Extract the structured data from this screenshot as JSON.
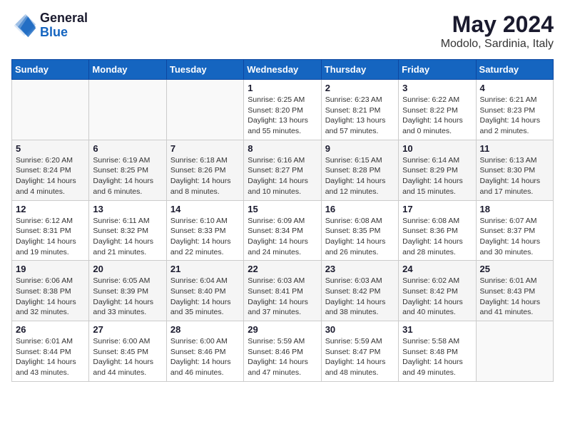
{
  "header": {
    "logo_line1": "General",
    "logo_line2": "Blue",
    "month_title": "May 2024",
    "location": "Modolo, Sardinia, Italy"
  },
  "days_of_week": [
    "Sunday",
    "Monday",
    "Tuesday",
    "Wednesday",
    "Thursday",
    "Friday",
    "Saturday"
  ],
  "weeks": [
    [
      {
        "day": "",
        "info": ""
      },
      {
        "day": "",
        "info": ""
      },
      {
        "day": "",
        "info": ""
      },
      {
        "day": "1",
        "info": "Sunrise: 6:25 AM\nSunset: 8:20 PM\nDaylight: 13 hours\nand 55 minutes."
      },
      {
        "day": "2",
        "info": "Sunrise: 6:23 AM\nSunset: 8:21 PM\nDaylight: 13 hours\nand 57 minutes."
      },
      {
        "day": "3",
        "info": "Sunrise: 6:22 AM\nSunset: 8:22 PM\nDaylight: 14 hours\nand 0 minutes."
      },
      {
        "day": "4",
        "info": "Sunrise: 6:21 AM\nSunset: 8:23 PM\nDaylight: 14 hours\nand 2 minutes."
      }
    ],
    [
      {
        "day": "5",
        "info": "Sunrise: 6:20 AM\nSunset: 8:24 PM\nDaylight: 14 hours\nand 4 minutes."
      },
      {
        "day": "6",
        "info": "Sunrise: 6:19 AM\nSunset: 8:25 PM\nDaylight: 14 hours\nand 6 minutes."
      },
      {
        "day": "7",
        "info": "Sunrise: 6:18 AM\nSunset: 8:26 PM\nDaylight: 14 hours\nand 8 minutes."
      },
      {
        "day": "8",
        "info": "Sunrise: 6:16 AM\nSunset: 8:27 PM\nDaylight: 14 hours\nand 10 minutes."
      },
      {
        "day": "9",
        "info": "Sunrise: 6:15 AM\nSunset: 8:28 PM\nDaylight: 14 hours\nand 12 minutes."
      },
      {
        "day": "10",
        "info": "Sunrise: 6:14 AM\nSunset: 8:29 PM\nDaylight: 14 hours\nand 15 minutes."
      },
      {
        "day": "11",
        "info": "Sunrise: 6:13 AM\nSunset: 8:30 PM\nDaylight: 14 hours\nand 17 minutes."
      }
    ],
    [
      {
        "day": "12",
        "info": "Sunrise: 6:12 AM\nSunset: 8:31 PM\nDaylight: 14 hours\nand 19 minutes."
      },
      {
        "day": "13",
        "info": "Sunrise: 6:11 AM\nSunset: 8:32 PM\nDaylight: 14 hours\nand 21 minutes."
      },
      {
        "day": "14",
        "info": "Sunrise: 6:10 AM\nSunset: 8:33 PM\nDaylight: 14 hours\nand 22 minutes."
      },
      {
        "day": "15",
        "info": "Sunrise: 6:09 AM\nSunset: 8:34 PM\nDaylight: 14 hours\nand 24 minutes."
      },
      {
        "day": "16",
        "info": "Sunrise: 6:08 AM\nSunset: 8:35 PM\nDaylight: 14 hours\nand 26 minutes."
      },
      {
        "day": "17",
        "info": "Sunrise: 6:08 AM\nSunset: 8:36 PM\nDaylight: 14 hours\nand 28 minutes."
      },
      {
        "day": "18",
        "info": "Sunrise: 6:07 AM\nSunset: 8:37 PM\nDaylight: 14 hours\nand 30 minutes."
      }
    ],
    [
      {
        "day": "19",
        "info": "Sunrise: 6:06 AM\nSunset: 8:38 PM\nDaylight: 14 hours\nand 32 minutes."
      },
      {
        "day": "20",
        "info": "Sunrise: 6:05 AM\nSunset: 8:39 PM\nDaylight: 14 hours\nand 33 minutes."
      },
      {
        "day": "21",
        "info": "Sunrise: 6:04 AM\nSunset: 8:40 PM\nDaylight: 14 hours\nand 35 minutes."
      },
      {
        "day": "22",
        "info": "Sunrise: 6:03 AM\nSunset: 8:41 PM\nDaylight: 14 hours\nand 37 minutes."
      },
      {
        "day": "23",
        "info": "Sunrise: 6:03 AM\nSunset: 8:42 PM\nDaylight: 14 hours\nand 38 minutes."
      },
      {
        "day": "24",
        "info": "Sunrise: 6:02 AM\nSunset: 8:42 PM\nDaylight: 14 hours\nand 40 minutes."
      },
      {
        "day": "25",
        "info": "Sunrise: 6:01 AM\nSunset: 8:43 PM\nDaylight: 14 hours\nand 41 minutes."
      }
    ],
    [
      {
        "day": "26",
        "info": "Sunrise: 6:01 AM\nSunset: 8:44 PM\nDaylight: 14 hours\nand 43 minutes."
      },
      {
        "day": "27",
        "info": "Sunrise: 6:00 AM\nSunset: 8:45 PM\nDaylight: 14 hours\nand 44 minutes."
      },
      {
        "day": "28",
        "info": "Sunrise: 6:00 AM\nSunset: 8:46 PM\nDaylight: 14 hours\nand 46 minutes."
      },
      {
        "day": "29",
        "info": "Sunrise: 5:59 AM\nSunset: 8:46 PM\nDaylight: 14 hours\nand 47 minutes."
      },
      {
        "day": "30",
        "info": "Sunrise: 5:59 AM\nSunset: 8:47 PM\nDaylight: 14 hours\nand 48 minutes."
      },
      {
        "day": "31",
        "info": "Sunrise: 5:58 AM\nSunset: 8:48 PM\nDaylight: 14 hours\nand 49 minutes."
      },
      {
        "day": "",
        "info": ""
      }
    ]
  ]
}
